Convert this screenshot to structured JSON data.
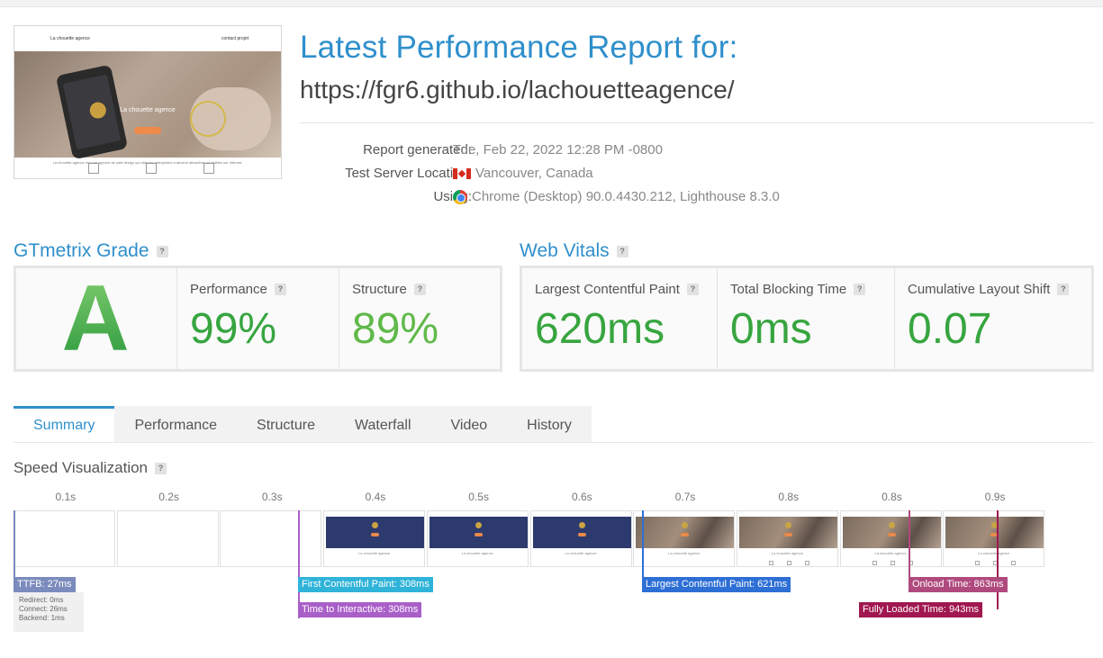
{
  "header": {
    "title": "Latest Performance Report for:",
    "url": "https://fgr6.github.io/lachouetteagence/",
    "meta": [
      {
        "label": "Report generated:",
        "value": "Tue, Feb 22, 2022 12:28 PM -0800",
        "icon": ""
      },
      {
        "label": "Test Server Location:",
        "value": "Vancouver, Canada",
        "icon": "canada-flag-icon"
      },
      {
        "label": "Using:",
        "value": "Chrome (Desktop) 90.0.4430.212, Lighthouse 8.3.0",
        "icon": "chrome-icon"
      }
    ]
  },
  "thumbnail": {
    "nav_brand": "La chouette agence",
    "nav_links": "contact   projet",
    "hero_title": "La chouette agence",
    "footer_text": "La chouette agence est une agence de web design qui aide les entreprises à devenir attractives et visibles sur Internet."
  },
  "grade": {
    "heading": "GTmetrix Grade",
    "help": "?",
    "letter": "A",
    "performance_label": "Performance",
    "performance_value": "99%",
    "structure_label": "Structure",
    "structure_value": "89%"
  },
  "vitals": {
    "heading": "Web Vitals",
    "help": "?",
    "items": [
      {
        "label": "Largest Contentful Paint",
        "value": "620ms"
      },
      {
        "label": "Total Blocking Time",
        "value": "0ms"
      },
      {
        "label": "Cumulative Layout Shift",
        "value": "0.07"
      }
    ]
  },
  "tabs": [
    "Summary",
    "Performance",
    "Structure",
    "Waterfall",
    "Video",
    "History"
  ],
  "active_tab": "Summary",
  "speed": {
    "title": "Speed Visualization",
    "help": "?",
    "ticks": [
      "0.1s",
      "0.2s",
      "0.3s",
      "0.4s",
      "0.5s",
      "0.6s",
      "0.7s",
      "0.8s",
      "0.8s",
      "0.9s"
    ],
    "frames": [
      "blank",
      "blank",
      "blank",
      "navy",
      "navy",
      "navy",
      "photo",
      "photo",
      "photo",
      "photo"
    ],
    "frame_caption": "La chouette agence",
    "ttfb": {
      "label": "TTFB: 27ms",
      "redirect": "Redirect: 0ms",
      "connect": "Connect: 26ms",
      "backend": "Backend: 1ms"
    },
    "markers": {
      "fcp": "First Contentful Paint: 308ms",
      "tti": "Time to Interactive: 308ms",
      "lcp": "Largest Contentful Paint: 621ms",
      "onload": "Onload Time: 863ms",
      "fully_loaded": "Fully Loaded Time: 943ms"
    }
  },
  "colors": {
    "accent": "#2f8fcc",
    "grade_green": "#37a53f",
    "structure_green": "#60b94a",
    "ttfb": "#7b8bbd",
    "fcp": "#2fb3d9",
    "tti": "#a95fc8",
    "lcp": "#2e6fd6",
    "onload": "#b04a7e",
    "fully_loaded": "#a0184f"
  }
}
